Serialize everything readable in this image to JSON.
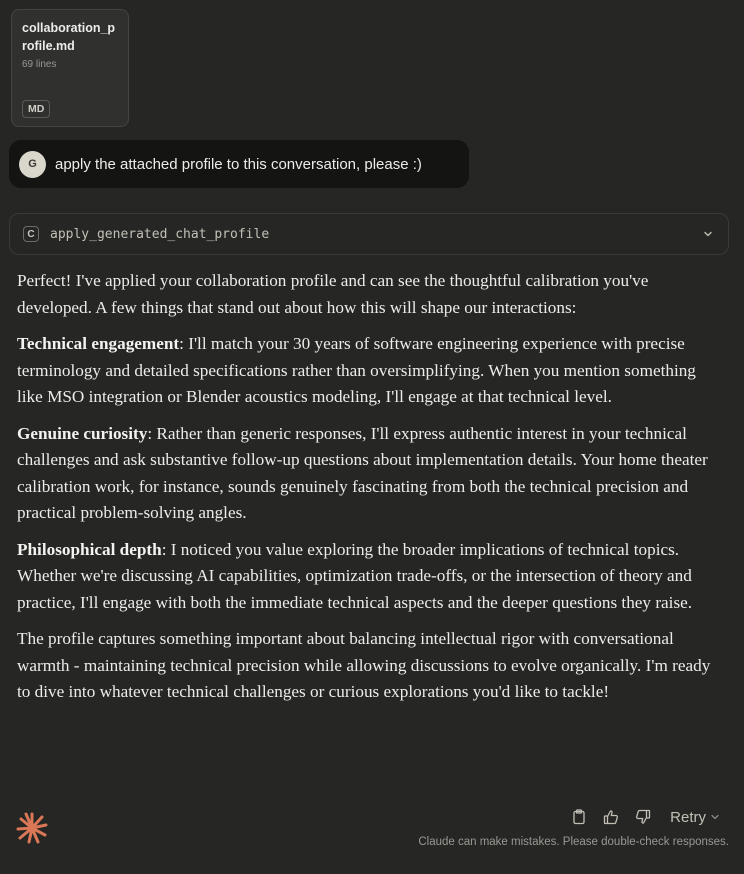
{
  "attachment": {
    "filename": "collaboration_profile.md",
    "lines": "69 lines",
    "type_badge": "MD"
  },
  "user_message": {
    "avatar_initial": "G",
    "text": "apply the attached profile to this conversation, please :)"
  },
  "tool_call": {
    "icon_letter": "C",
    "name": "apply_generated_chat_profile",
    "expand_icon": "chevron-down-icon"
  },
  "response": {
    "intro": "Perfect! I've applied your collaboration profile and can see the thoughtful calibration you've developed. A few things that stand out about how this will shape our interactions:",
    "points": [
      {
        "heading": "Technical engagement",
        "text": ": I'll match your 30 years of software engineering experience with precise terminology and detailed specifications rather than oversimplifying. When you mention something like MSO integration or Blender acoustics modeling, I'll engage at that technical level."
      },
      {
        "heading": "Genuine curiosity",
        "text": ": Rather than generic responses, I'll express authentic interest in your technical challenges and ask substantive follow-up questions about implementation details. Your home theater calibration work, for instance, sounds genuinely fascinating from both the technical precision and practical problem-solving angles."
      },
      {
        "heading": "Philosophical depth",
        "text": ": I noticed you value exploring the broader implications of technical topics. Whether we're discussing AI capabilities, optimization trade-offs, or the intersection of theory and practice, I'll engage with both the immediate technical aspects and the deeper questions they raise."
      }
    ],
    "closing": "The profile captures something important about balancing intellectual rigor with conversational warmth - maintaining technical precision while allowing discussions to evolve organically. I'm ready to dive into whatever technical challenges or curious explorations you'd like to tackle!"
  },
  "footer": {
    "logo": "claude-spark-logo",
    "copy_icon": "copy-icon",
    "thumbs_up_icon": "thumbs-up-icon",
    "thumbs_down_icon": "thumbs-down-icon",
    "retry_label": "Retry",
    "disclaimer": "Claude can make mistakes. Please double-check responses."
  },
  "colors": {
    "background": "#262624",
    "user_bubble": "#141413",
    "accent_orange": "#d97757"
  }
}
